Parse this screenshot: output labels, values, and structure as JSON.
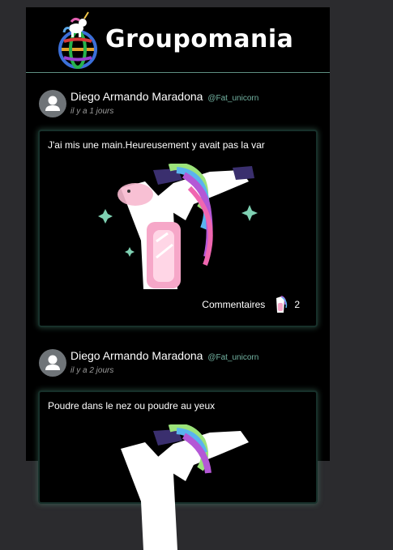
{
  "header": {
    "brand": "Groupomania",
    "logo_icon": "unicorn-globe-logo-icon"
  },
  "posts": [
    {
      "author": "Diego Armando Maradona",
      "handle": "@Fat_unicorn",
      "date": "il y a 1 jours",
      "text": "J'ai mis une main.Heureusement y avait pas la var",
      "comments_label": "Commentaires",
      "comments_count": "2",
      "media_icon": "dabbing-unicorn-icon"
    },
    {
      "author": "Diego Armando Maradona",
      "handle": "@Fat_unicorn",
      "date": "il y a 2 jours",
      "text": "Poudre dans le nez ou poudre au yeux",
      "media_icon": "dabbing-unicorn-icon"
    }
  ],
  "colors": {
    "accent": "#73b3a2",
    "background": "#000000",
    "page": "#2b2b2e"
  }
}
